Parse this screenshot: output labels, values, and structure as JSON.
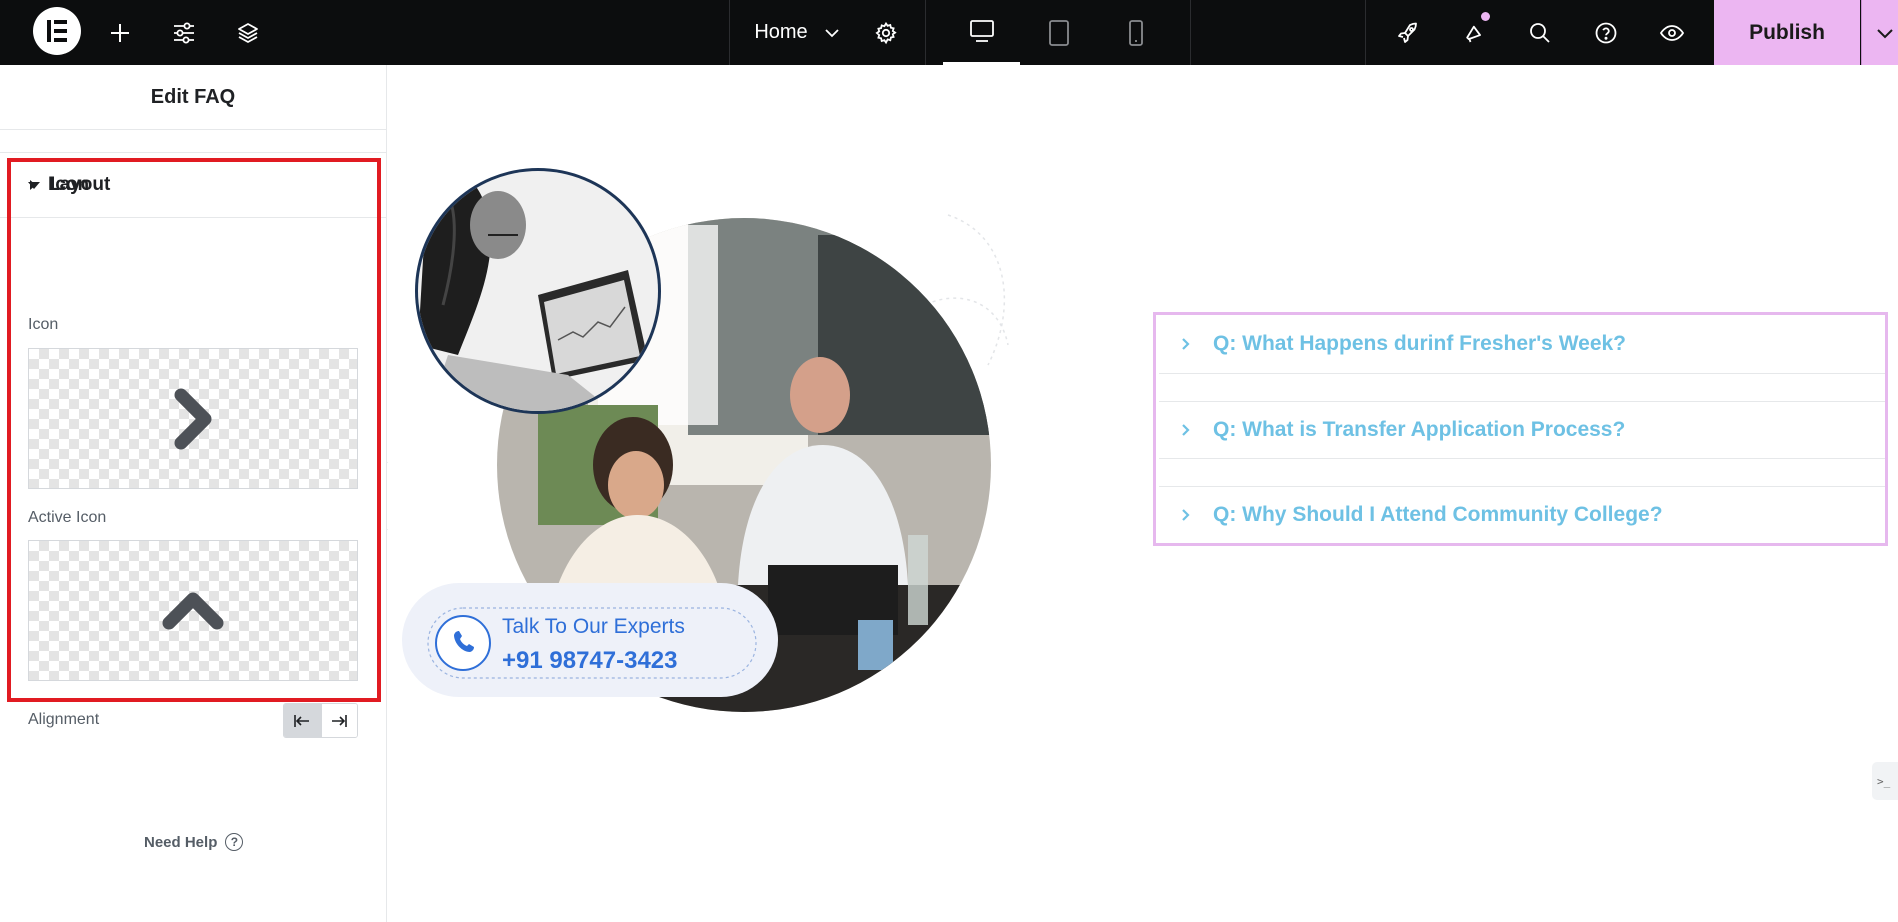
{
  "topbar": {
    "page_name": "Home",
    "publish_label": "Publish"
  },
  "panel": {
    "title": "Edit FAQ",
    "sections": {
      "layout_label": "Layout",
      "icon_label": "Icon"
    },
    "controls": {
      "icon_label": "Icon",
      "active_icon_label": "Active Icon",
      "alignment_label": "Alignment"
    },
    "need_help_label": "Need Help",
    "help_glyph": "?"
  },
  "canvas": {
    "cta": {
      "title": "Talk To Our Experts",
      "phone": "+91 98747-3423"
    },
    "faq": {
      "items": [
        {
          "question": "Q: What Happens durinf Fresher's Week?"
        },
        {
          "question": "Q: What is Transfer Application Process?"
        },
        {
          "question": "Q: Why Should I Attend Community College?"
        }
      ]
    },
    "side_badge": ">_"
  },
  "colors": {
    "accent_pink": "#ecb6f2",
    "faq_text": "#6ec1e4",
    "highlight_red": "#e11b22",
    "topbar_bg": "#0c0d0e",
    "cta_blue": "#2f6fd8"
  }
}
